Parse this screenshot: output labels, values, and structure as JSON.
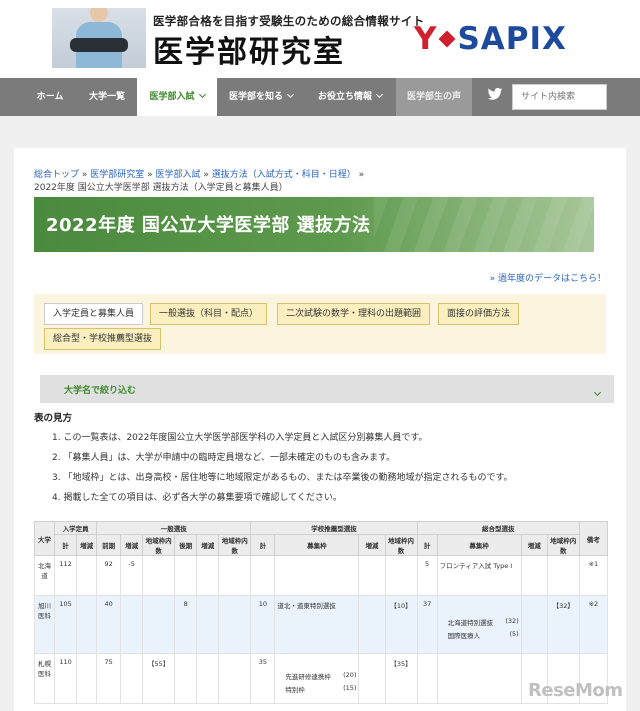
{
  "header": {
    "tagline": "医学部合格を目指す受験生のための総合情報サイト",
    "site_title": "医学部研究室",
    "sapix_y": "Y",
    "sapix_rest": "SAPIX"
  },
  "nav": {
    "items": [
      {
        "label": "ホーム"
      },
      {
        "label": "大学一覧"
      },
      {
        "label": "医学部入試"
      },
      {
        "label": "医学部を知る"
      },
      {
        "label": "お役立ち情報"
      },
      {
        "label": "医学部生の声"
      }
    ],
    "search_placeholder": "サイト内検索"
  },
  "breadcrumb": {
    "items": [
      "総合トップ",
      "医学部研究室",
      "医学部入試",
      "選抜方法（入試方式・科目・日程）"
    ],
    "current": "2022年度 国公立大学医学部 選抜方法（入学定員と募集人員）"
  },
  "page_title": "2022年度 国公立大学医学部 選抜方法",
  "past_data_link": "» 過年度のデータはこちら！",
  "tabs": [
    {
      "label": "入学定員と募集人員"
    },
    {
      "label": "一般選抜（科目・配点）"
    },
    {
      "label": "二次試験の数学・理科の出題範囲"
    },
    {
      "label": "面接の評価方法"
    },
    {
      "label": "総合型・学校推薦型選抜"
    }
  ],
  "filter_label": "大学名で絞り込む",
  "howto": {
    "title": "表の見方",
    "notes": [
      "1. この一覧表は、2022年度国公立大学医学部医学科の入学定員と入試区分別募集人員です。",
      "2. 「募集人員」は、大学が申請中の臨時定員増など、一部未確定のものも含みます。",
      "3. 「地域枠」とは、出身高校・居住地等に地域限定があるもの、または卒業後の勤務地域が指定されるものです。",
      "4. 掲載した全ての項目は、必ず各大学の募集要項で確認してください。"
    ]
  },
  "table": {
    "group_headers": [
      "大学",
      "入学定員",
      "一般選抜",
      "学校推薦型選抜",
      "総合型選抜",
      "備考"
    ],
    "sub_headers": [
      "計",
      "増減",
      "前期",
      "増減",
      "地域枠内数",
      "後期",
      "増減",
      "地域枠内数",
      "計",
      "募集枠",
      "増減",
      "地域枠内数",
      "計",
      "募集枠",
      "増減",
      "地域枠内数"
    ],
    "rows": [
      {
        "univ": "北海道",
        "capacity": "112",
        "cap_change": "",
        "zenki": "92",
        "zenki_change": "-5",
        "zenki_local": "",
        "kouki": "",
        "kouki_change": "",
        "kouki_local": "",
        "suisen_total": "",
        "suisen_frame": "",
        "suisen_change": "",
        "suisen_local": "",
        "sogo_total": "5",
        "sogo_frame": "フロンティア入試 Type I",
        "sogo_change": "",
        "sogo_local": "",
        "note": "※1",
        "sub": []
      },
      {
        "univ": "旭川医科",
        "capacity": "105",
        "cap_change": "",
        "zenki": "40",
        "zenki_change": "",
        "zenki_local": "",
        "kouki": "8",
        "kouki_change": "",
        "kouki_local": "",
        "suisen_total": "10",
        "suisen_frame": "道北・道東特別選抜",
        "suisen_change": "",
        "suisen_local": "【10】",
        "sogo_total": "37",
        "sogo_frame": "",
        "sogo_change": "",
        "sogo_local": "【32】",
        "note": "※2",
        "sub": [
          {
            "label": "北海道特別選抜",
            "value": "(32)"
          },
          {
            "label": "国際医療人",
            "value": "(5)"
          }
        ]
      },
      {
        "univ": "札幌医科",
        "capacity": "110",
        "cap_change": "",
        "zenki": "75",
        "zenki_change": "",
        "zenki_local": "【55】",
        "kouki": "",
        "kouki_change": "",
        "kouki_local": "",
        "suisen_total": "35",
        "suisen_frame": "",
        "suisen_change": "",
        "suisen_local": "【35】",
        "sogo_total": "",
        "sogo_frame": "",
        "sogo_change": "",
        "sogo_local": "",
        "note": "",
        "sub": [
          {
            "label": "先進研修連携枠",
            "value": "(20)"
          },
          {
            "label": "特別枠",
            "value": "(15)"
          }
        ]
      }
    ]
  },
  "watermark": "ReseMom"
}
